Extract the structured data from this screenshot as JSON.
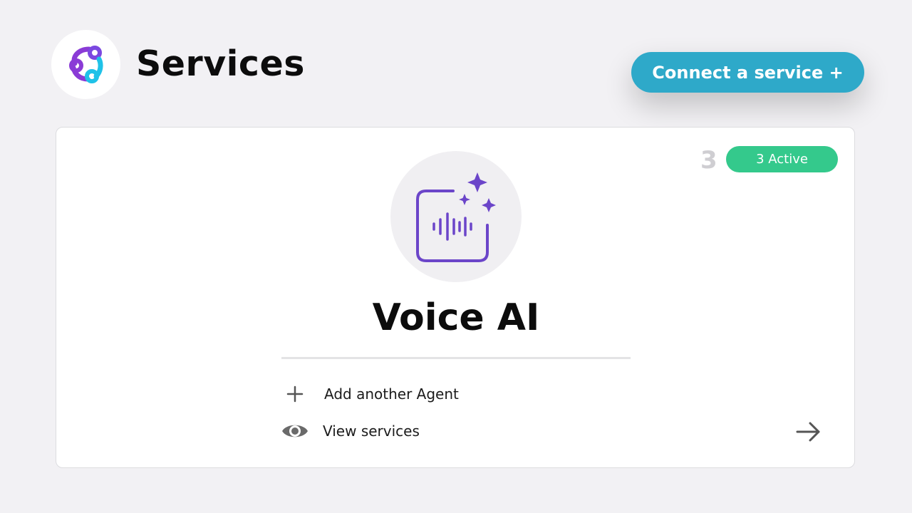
{
  "header": {
    "title": "Services",
    "logo_icon": "services-logo-icon",
    "connect_button_label": "Connect a service +"
  },
  "card": {
    "count": "3",
    "badge_label": "3 Active",
    "icon": "voice-ai-sparkle-icon",
    "service_name": "Voice AI",
    "actions": [
      {
        "icon": "plus-icon",
        "label": "Add another Agent"
      },
      {
        "icon": "eye-icon",
        "label": "View services"
      }
    ],
    "arrow_icon": "arrow-right-icon"
  },
  "colors": {
    "background": "#f2f1f4",
    "connect_button": "#2ea9c9",
    "active_badge": "#34c98c",
    "voice_icon_purple": "#6b45c9",
    "logo_purple": "#8a3bd6",
    "logo_cyan": "#1fc2e8"
  }
}
